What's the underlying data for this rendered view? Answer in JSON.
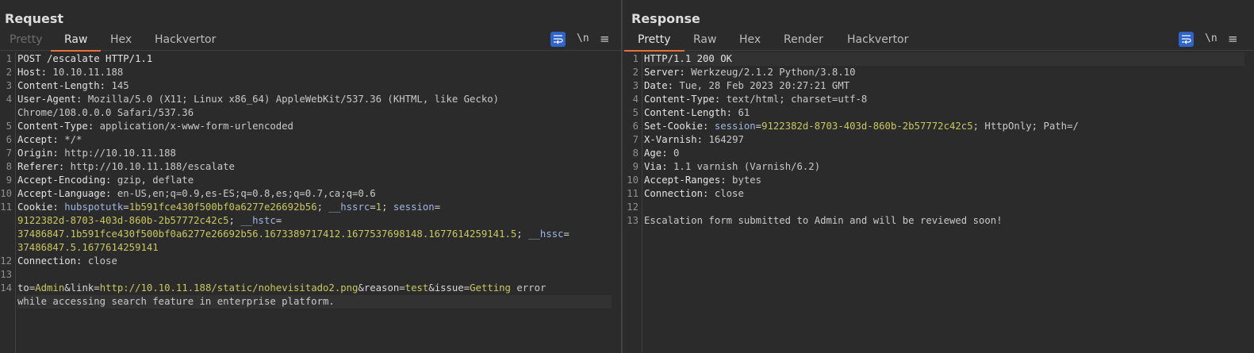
{
  "request": {
    "title": "Request",
    "tabs": [
      "Pretty",
      "Raw",
      "Hex",
      "Hackvertor"
    ],
    "active_tab": "Raw",
    "newline_label": "\\n",
    "menu_label": "≡",
    "gutter": [
      "1",
      "2",
      "3",
      "4",
      "",
      "5",
      "6",
      "7",
      "8",
      "9",
      "10",
      "11",
      "",
      "",
      "",
      "12",
      "13",
      "14",
      ""
    ],
    "lines": {
      "l1": "POST /escalate HTTP/1.1",
      "l2n": "Host:",
      "l2v": " 10.10.11.188",
      "l3n": "Content-Length:",
      "l3v": " 145",
      "l4n": "User-Agent:",
      "l4v": " Mozilla/5.0 (X11; Linux x86_64) AppleWebKit/537.36 (KHTML, like Gecko)",
      "l4c": "Chrome/108.0.0.0 Safari/537.36",
      "l5n": "Content-Type:",
      "l5v": " application/x-www-form-urlencoded",
      "l6n": "Accept:",
      "l6v": " */*",
      "l7n": "Origin:",
      "l7v": " http://10.10.11.188",
      "l8n": "Referer:",
      "l8v": " http://10.10.11.188/escalate",
      "l9n": "Accept-Encoding:",
      "l9v": " gzip, deflate",
      "l10n": "Accept-Language:",
      "l10v": " en-US,en;q=0.9,es-ES;q=0.8,es;q=0.7,ca;q=0.6",
      "l11n": "Cookie:",
      "c1k": "hubspotutk",
      "c1v": "1b591fce430f500bf0a6277e26692b56",
      "c2k": "__hssrc",
      "c2v": "1",
      "c3k": "session",
      "c3v": "9122382d-8703-403d-860b-2b57772c42c5",
      "c4k": "__hstc",
      "c4v": "37486847.1b591fce430f500bf0a6277e26692b56.1673389717412.1677537698148.1677614259141.5",
      "c5k": "__hssc",
      "c5v": "37486847.5.1677614259141",
      "l12n": "Connection:",
      "l12v": " close",
      "p1k": "to",
      "p1v": "Admin",
      "p2k": "link",
      "p2v": "http://10.10.11.188/static/nohevisitado2.png",
      "p3k": "reason",
      "p3v": "test",
      "p4k": "issue",
      "p4v": "Getting",
      "p4rest": " error",
      "p4cont": "while accessing search feature in enterprise platform."
    }
  },
  "response": {
    "title": "Response",
    "tabs": [
      "Pretty",
      "Raw",
      "Hex",
      "Render",
      "Hackvertor"
    ],
    "active_tab": "Pretty",
    "newline_label": "\\n",
    "menu_label": "≡",
    "gutter": [
      "1",
      "2",
      "3",
      "4",
      "5",
      "6",
      "7",
      "8",
      "9",
      "10",
      "11",
      "12",
      "13"
    ],
    "lines": {
      "l1": "HTTP/1.1 200 OK",
      "l2n": "Server:",
      "l2v": " Werkzeug/2.1.2 Python/3.8.10",
      "l3n": "Date:",
      "l3v": " Tue, 28 Feb 2023 20:27:21 GMT",
      "l4n": "Content-Type:",
      "l4v": " text/html; charset=utf-8",
      "l5n": "Content-Length:",
      "l5v": " 61",
      "l6n": "Set-Cookie:",
      "l6k": "session",
      "l6cv": "9122382d-8703-403d-860b-2b57772c42c5",
      "l6rest": "; HttpOnly; Path=/",
      "l7n": "X-Varnish:",
      "l7v": " 164297",
      "l8n": "Age:",
      "l8v": " 0",
      "l9n": "Via:",
      "l9v": " 1.1 varnish (Varnish/6.2)",
      "l10n": "Accept-Ranges:",
      "l10v": " bytes",
      "l11n": "Connection:",
      "l11v": " close",
      "l13": "Escalation form submitted to Admin and will be reviewed soon!"
    }
  },
  "colors": {
    "accent": "#e8703a",
    "button_blue": "#2f65ca",
    "value_green": "#c8c85e",
    "key_blue": "#9fb6e0"
  },
  "icons": [
    "word-wrap-icon",
    "layout-side-by-side-icon",
    "layout-stacked-icon",
    "layout-single-icon"
  ]
}
